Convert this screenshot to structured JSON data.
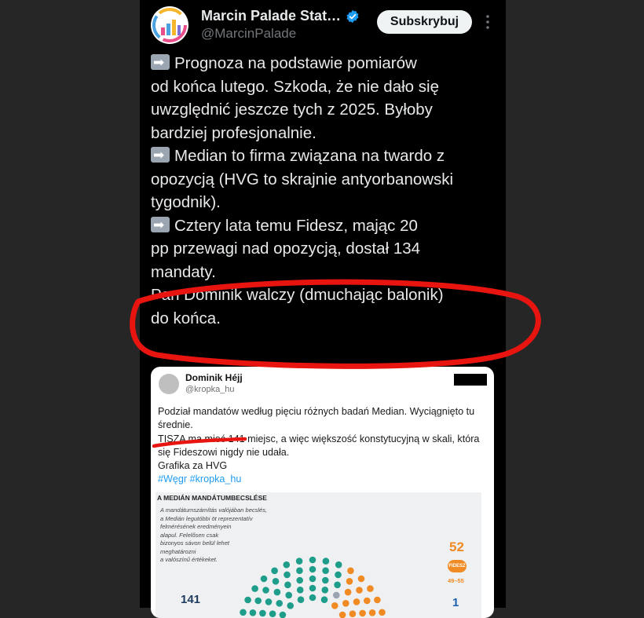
{
  "author": {
    "display_name": "Marcin Palade Stat…",
    "handle": "@MarcinPalade",
    "verified_icon": "verified-badge-icon"
  },
  "actions": {
    "subscribe_label": "Subskrybuj",
    "more_icon": "more-vertical-icon"
  },
  "tweet": {
    "lines": [
      "Prognoza na podstawie pomiarów",
      "od końca lutego. Szkoda, że nie dało się",
      "uwzględnić jeszcze tych z 2025. Byłoby",
      "bardziej profesjonalnie.",
      "Median to firma związana na twardo z",
      "opozycją (HVG to skrajnie antyorbanowski",
      "tygodnik).",
      "Cztery lata temu Fidesz, mając 20",
      "pp przewagi nad opozycją, dostał 134",
      "mandaty.",
      "",
      "Pan Dominik walczy (dmuchając balonik)",
      "do końca."
    ]
  },
  "quoted": {
    "author_name": "Dominik Héjj",
    "author_handle": "@kropka_hu",
    "lines": [
      "Podział mandatów według pięciu różnych badań Median. Wyciągnięto tu",
      "średnie.",
      "TISZA ma mieć 141 miejsc, a więc większość konstytucyjną w skali, która",
      "się Fideszowi nigdy nie udała.",
      "Grafika za HVG",
      "#Węgr #kropka_hu"
    ],
    "graphic": {
      "title": "A MEDIÁN MANDÁTUMBECSLÉSE",
      "note_lines": [
        "A mandátumszámítás valójában becslés,",
        "a Medián legutóbbi öt reprezentatív",
        "felmérésének eredményein",
        "alapul. Felelősen csak",
        "bizonyos sávon belül lehet",
        "meghatározni",
        "a valószínű értékeket."
      ],
      "fidesz_value": "52",
      "fidesz_label": "FIDESZ",
      "fidesz_range": "49–55",
      "tisza_value": "141",
      "other_value": "1",
      "colors": {
        "tisza": "#1e9e8a",
        "fidesz": "#f08a22",
        "other": "#1f5fb0"
      }
    }
  },
  "colors": {
    "background": "#262626",
    "panel": "#000000",
    "text": "#e7e9ea",
    "muted": "#71767b",
    "annotation": "#e8140f",
    "verified": "#1d9bf0"
  }
}
